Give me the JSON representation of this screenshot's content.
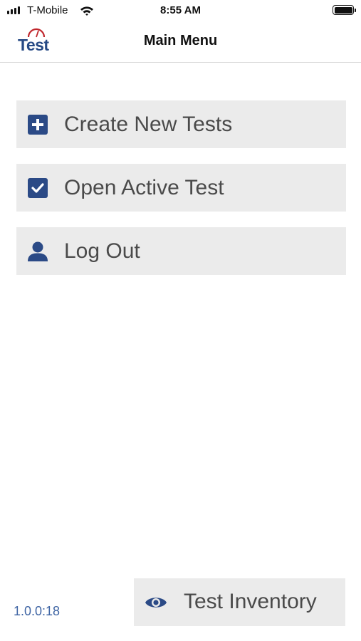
{
  "status_bar": {
    "carrier": "T-Mobile",
    "time": "8:55 AM",
    "icons": [
      "signal-icon",
      "wifi-icon",
      "battery-icon"
    ]
  },
  "header": {
    "logo_text": "Test",
    "title": "Main Menu"
  },
  "menu": {
    "items": [
      {
        "label": "Create New Tests",
        "icon": "plus-square-icon"
      },
      {
        "label": "Open Active Test",
        "icon": "checkbox-icon"
      },
      {
        "label": "Log Out",
        "icon": "user-icon"
      }
    ]
  },
  "footer": {
    "version": "1.0.0:18",
    "inventory_label": "Test Inventory",
    "inventory_icon": "eye-icon"
  },
  "colors": {
    "accent": "#2b4a86",
    "button_bg": "#ebebeb",
    "version_text": "#3f65a4",
    "logo_red": "#c0272d"
  }
}
